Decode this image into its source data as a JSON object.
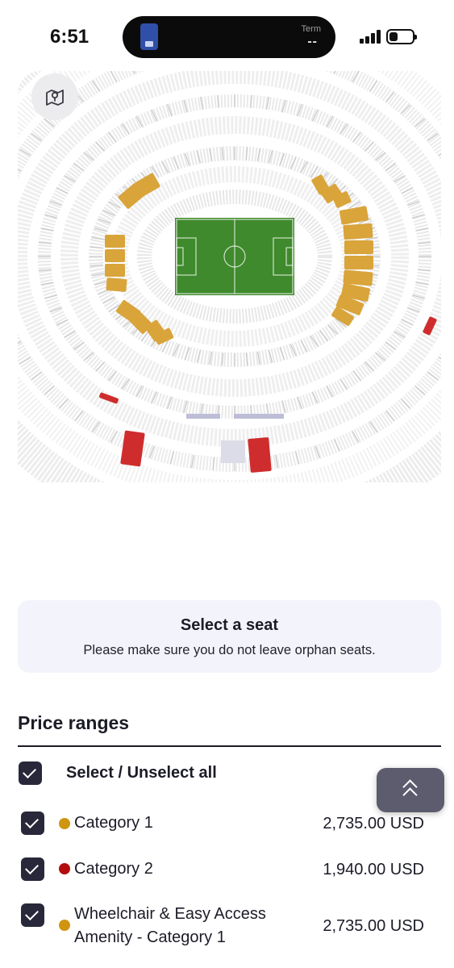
{
  "status_bar": {
    "time": "6:51",
    "live_activity": {
      "label": "Term",
      "value": "--"
    }
  },
  "map": {
    "toggle_icon": "map-pin-icon",
    "colors": {
      "category_1": "#d9a43a",
      "category_2": "#cf2d2d",
      "pitch": "#3f8a2c",
      "unavailable": "#e6e6e6"
    }
  },
  "seat_panel": {
    "title": "Select a seat",
    "hint": "Please make sure you do not leave orphan seats."
  },
  "price_ranges": {
    "title": "Price ranges",
    "select_all_label": "Select / Unselect all",
    "select_all_checked": true,
    "categories": [
      {
        "label": "Category 1",
        "price": "2,735.00 USD",
        "dot_color": "#cf9510",
        "checked": true
      },
      {
        "label": "Category 2",
        "price": "1,940.00 USD",
        "dot_color": "#b30d0d",
        "checked": true
      },
      {
        "label_line1": "Wheelchair & Easy Access",
        "label_line2": "Amenity - Category 1",
        "price": "2,735.00 USD",
        "dot_color": "#cf9510",
        "checked": true
      }
    ]
  },
  "scroll_top_icon": "double-chevron-up-icon"
}
